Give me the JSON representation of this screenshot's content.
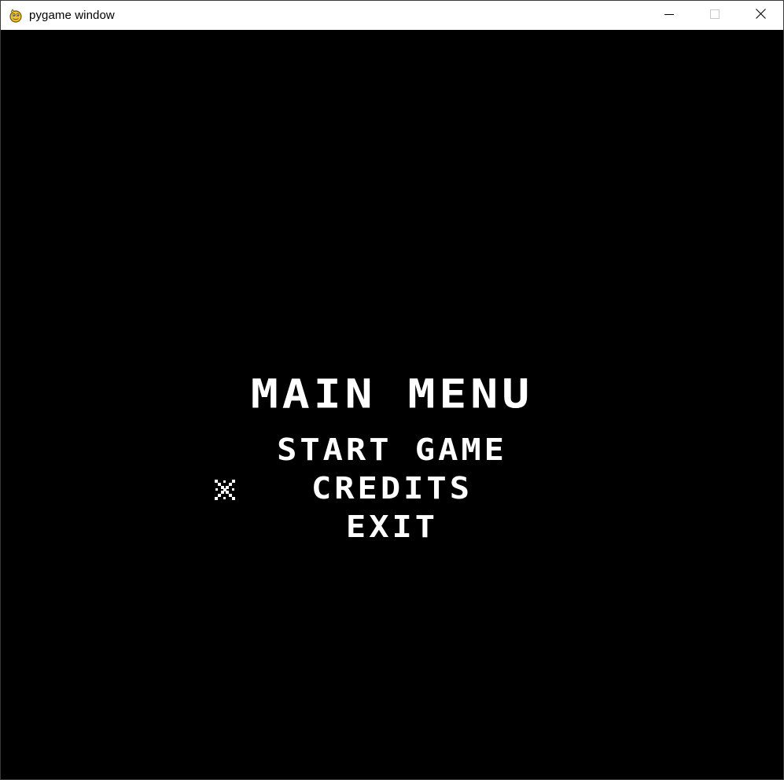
{
  "window": {
    "title": "pygame window",
    "icon": "pygame-snake-icon",
    "controls": {
      "minimize_icon": "minimize-icon",
      "maximize_icon": "maximize-icon",
      "close_icon": "close-icon"
    }
  },
  "game": {
    "background": "#000000",
    "text_color": "#ffffff",
    "menu_title": "MAIN MENU",
    "menu_items": [
      {
        "label": "START GAME"
      },
      {
        "label": "CREDITS",
        "selected": true
      },
      {
        "label": "EXIT"
      }
    ],
    "cursor_icon": "pixel-x-cursor-icon"
  }
}
